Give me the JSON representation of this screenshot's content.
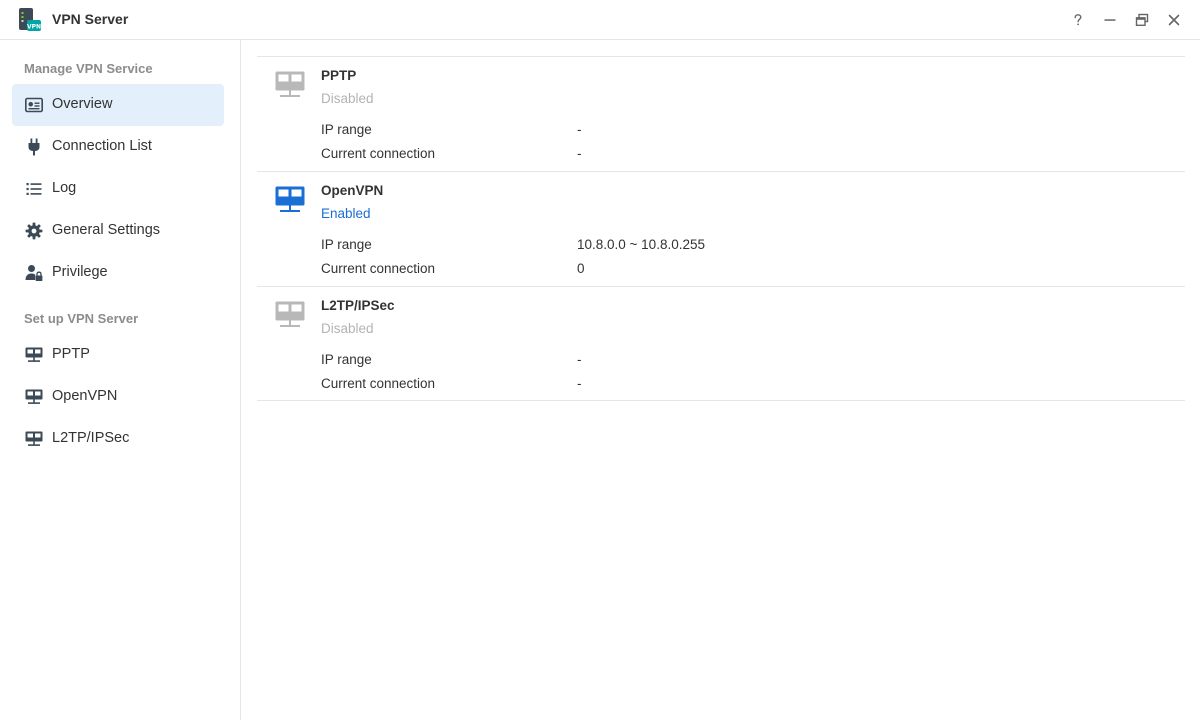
{
  "window": {
    "title": "VPN Server",
    "app_icon_text": "VPN",
    "controls": [
      "help-icon",
      "minimize-icon",
      "restore-icon",
      "close-icon"
    ]
  },
  "sidebar": {
    "sections": [
      {
        "title": "Manage VPN Service"
      },
      {
        "title": "Set up VPN Server"
      }
    ],
    "items": [
      {
        "label": "Overview",
        "icon": "overview-icon",
        "active": true
      },
      {
        "label": "Connection List",
        "icon": "plug-icon",
        "active": false
      },
      {
        "label": "Log",
        "icon": "list-icon",
        "active": false
      },
      {
        "label": "General Settings",
        "icon": "gear-icon",
        "active": false
      },
      {
        "label": "Privilege",
        "icon": "user-lock-icon",
        "active": false
      },
      {
        "label": "PPTP",
        "icon": "network-icon",
        "active": false
      },
      {
        "label": "OpenVPN",
        "icon": "network-icon",
        "active": false
      },
      {
        "label": "L2TP/IPSec",
        "icon": "network-icon",
        "active": false
      }
    ]
  },
  "services": [
    {
      "name": "PPTP",
      "status": "Disabled",
      "enabled": false,
      "ip_range_label": "IP range",
      "ip_range_value": "-",
      "current_connection_label": "Current connection",
      "current_connection_value": "-"
    },
    {
      "name": "OpenVPN",
      "status": "Enabled",
      "enabled": true,
      "ip_range_label": "IP range",
      "ip_range_value": "10.8.0.0 ~ 10.8.0.255",
      "current_connection_label": "Current connection",
      "current_connection_value": "0"
    },
    {
      "name": "L2TP/IPSec",
      "status": "Disabled",
      "enabled": false,
      "ip_range_label": "IP range",
      "ip_range_value": "-",
      "current_connection_label": "Current connection",
      "current_connection_value": "-"
    }
  ],
  "colors": {
    "accent": "#1a6fd4",
    "active_bg": "#e3f0fb",
    "disabled_text": "#b3b3b3",
    "disabled_icon": "#b8b8b8"
  }
}
